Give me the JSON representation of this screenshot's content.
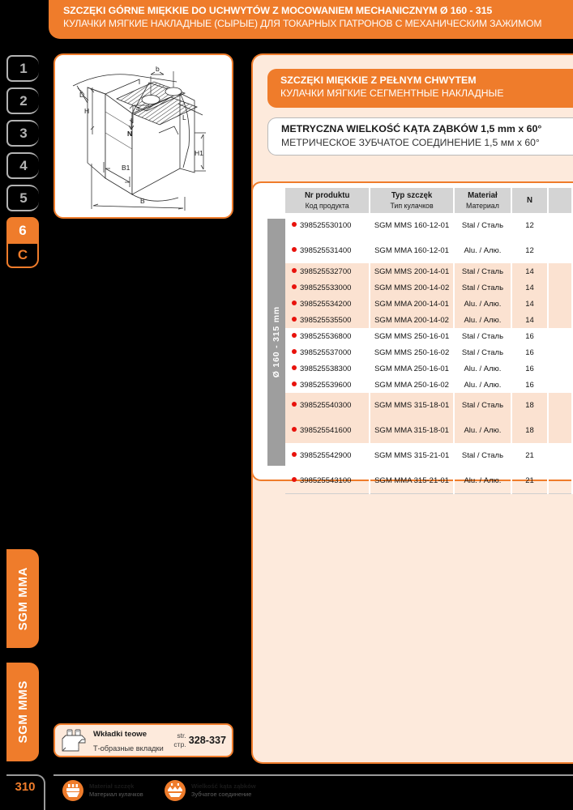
{
  "header": {
    "title_pl": "SZCZĘKI GÓRNE MIĘKKIE DO UCHWYTÓW Z MOCOWANIEM MECHANICZNYM Ø 160 - 315",
    "title_ru": "КУЛАЧКИ МЯГКИЕ НАКЛАДНЫЕ (СЫРЫЕ) ДЛЯ ТОКАРНЫХ ПАТРОНОВ С МЕХАНИЧЕСКИМ ЗАЖИМОМ"
  },
  "register_tabs": [
    {
      "label": "1",
      "active": false
    },
    {
      "label": "2",
      "active": false
    },
    {
      "label": "3",
      "active": false
    },
    {
      "label": "4",
      "active": false
    },
    {
      "label": "5",
      "active": false
    },
    {
      "label": "6",
      "active": true
    },
    {
      "label": "C",
      "active": false
    }
  ],
  "drawing": {
    "dimension_labels": [
      "D",
      "H",
      "b",
      "a",
      "N",
      "L",
      "H1",
      "B1",
      "B"
    ]
  },
  "sub_banner": {
    "title_pl": "SZCZĘKI MIĘKKIE Z PEŁNYM CHWYTEM",
    "title_ru": "КУЛАЧКИ МЯГКИЕ СЕГМЕНТНЫЕ НАКЛАДНЫЕ"
  },
  "spec_box": {
    "title_pl": "METRYCZNA WIELKOŚĆ KĄTA ZĄBKÓW 1,5 mm x 60°",
    "title_ru": "МЕТРИЧЕСКОЕ ЗУБЧАТОЕ СОЕДИНЕНИЕ 1,5 мм x 60°"
  },
  "table": {
    "group_label": "Ø 160 - 315 mm",
    "headers": [
      {
        "pl": "Nr produktu",
        "ru": "Код продукта"
      },
      {
        "pl": "Typ szczęk",
        "ru": "Тип кулачков"
      },
      {
        "pl": "Materiał",
        "ru": "Материал"
      },
      {
        "pl": "N",
        "ru": ""
      },
      {
        "pl": "",
        "ru": ""
      }
    ],
    "rows": [
      {
        "code": "398525530100",
        "type": "SGM MMS 160-12-01",
        "material": "Stal / Сталь",
        "n": "12",
        "alt": false,
        "tall": true
      },
      {
        "code": "398525531400",
        "type": "SGM MMA 160-12-01",
        "material": "Alu. / Алю.",
        "n": "12",
        "alt": false,
        "tall": true
      },
      {
        "code": "398525532700",
        "type": "SGM MMS 200-14-01",
        "material": "Stal / Сталь",
        "n": "14",
        "alt": true,
        "tall": false
      },
      {
        "code": "398525533000",
        "type": "SGM MMS 200-14-02",
        "material": "Stal / Сталь",
        "n": "14",
        "alt": true,
        "tall": false
      },
      {
        "code": "398525534200",
        "type": "SGM MMA 200-14-01",
        "material": "Alu. / Алю.",
        "n": "14",
        "alt": true,
        "tall": false
      },
      {
        "code": "398525535500",
        "type": "SGM MMA 200-14-02",
        "material": "Alu. / Алю.",
        "n": "14",
        "alt": true,
        "tall": false
      },
      {
        "code": "398525536800",
        "type": "SGM MMS 250-16-01",
        "material": "Stal / Сталь",
        "n": "16",
        "alt": false,
        "tall": false
      },
      {
        "code": "398525537000",
        "type": "SGM MMS 250-16-02",
        "material": "Stal / Сталь",
        "n": "16",
        "alt": false,
        "tall": false
      },
      {
        "code": "398525538300",
        "type": "SGM MMA 250-16-01",
        "material": "Alu. / Алю.",
        "n": "16",
        "alt": false,
        "tall": false
      },
      {
        "code": "398525539600",
        "type": "SGM MMA 250-16-02",
        "material": "Alu. / Алю.",
        "n": "16",
        "alt": false,
        "tall": false
      },
      {
        "code": "398525540300",
        "type": "SGM MMS 315-18-01",
        "material": "Stal / Сталь",
        "n": "18",
        "alt": true,
        "tall": true
      },
      {
        "code": "398525541600",
        "type": "SGM MMA 315-18-01",
        "material": "Alu. / Алю.",
        "n": "18",
        "alt": true,
        "tall": true
      },
      {
        "code": "398525542900",
        "type": "SGM MMS 315-21-01",
        "material": "Stal / Сталь",
        "n": "21",
        "alt": false,
        "tall": true
      },
      {
        "code": "398525543100",
        "type": "SGM MMA 315-21-01",
        "material": "Alu. / Алю.",
        "n": "21",
        "alt": false,
        "tall": true
      }
    ]
  },
  "side_tabs": [
    {
      "label": "SGM MMA"
    },
    {
      "label": "SGM MMS"
    }
  ],
  "xref": {
    "title_pl": "Wkładki teowe",
    "title_ru": "Т-образные вкладки",
    "page_label_pl": "str.",
    "page_label_ru": "стр.",
    "pages": "328-337"
  },
  "footer": {
    "page_number": "310",
    "legend": [
      {
        "pl": "Materiał szczęk",
        "ru": "Материал кулачков",
        "icon": "jaw-material-icon"
      },
      {
        "pl": "Wielkość kąta ząbków",
        "ru": "Зубчатое соединение",
        "icon": "serration-angle-icon"
      }
    ]
  },
  "colors": {
    "accent_orange": "#ef7c2b",
    "peach_bg": "#fdeadc",
    "alt_row": "#fbe2d1",
    "header_gray": "#d4d4d4",
    "group_gray": "#9e9e9e",
    "dot_red": "#e8120c",
    "page_bg": "#000000"
  }
}
